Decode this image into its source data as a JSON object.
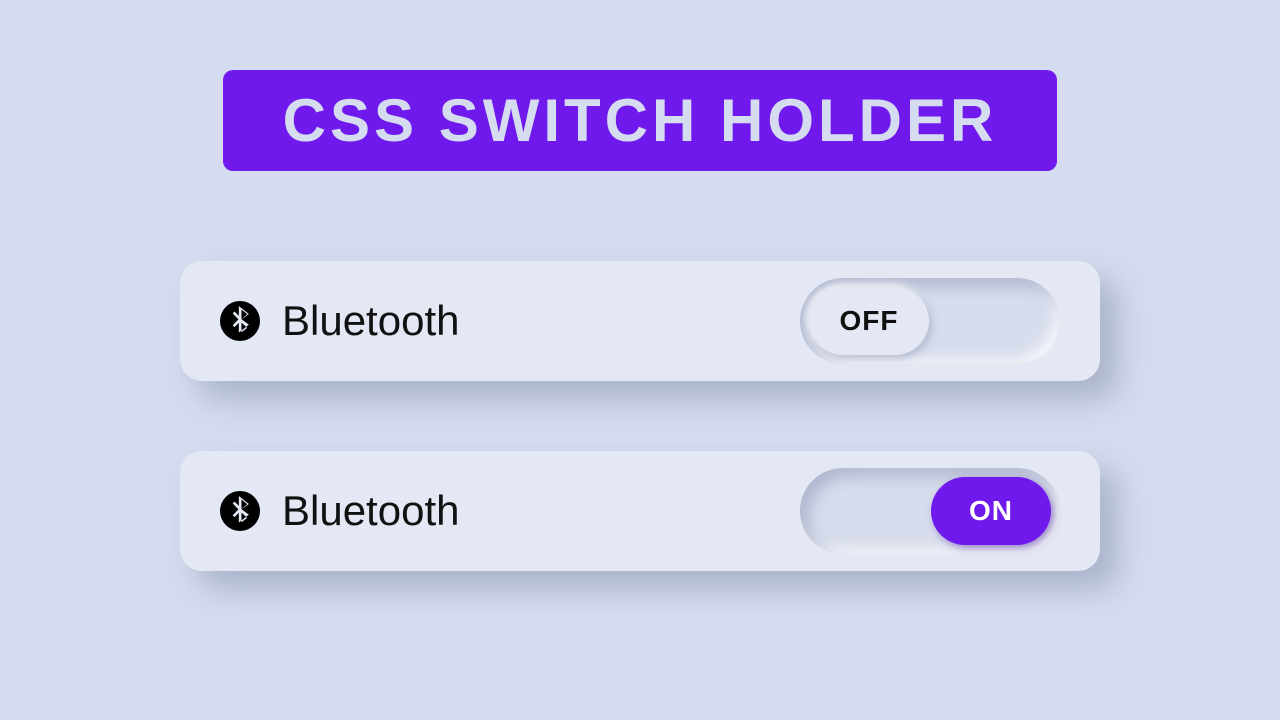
{
  "header": {
    "title": "CSS SWITCH HOLDER"
  },
  "colors": {
    "accent": "#6f19ed",
    "bg": "#d5dcef",
    "card": "#e3e8f4"
  },
  "switches": [
    {
      "icon": "bluetooth-icon",
      "label": "Bluetooth",
      "state": "off",
      "state_label": "OFF"
    },
    {
      "icon": "bluetooth-icon",
      "label": "Bluetooth",
      "state": "on",
      "state_label": "ON"
    }
  ]
}
